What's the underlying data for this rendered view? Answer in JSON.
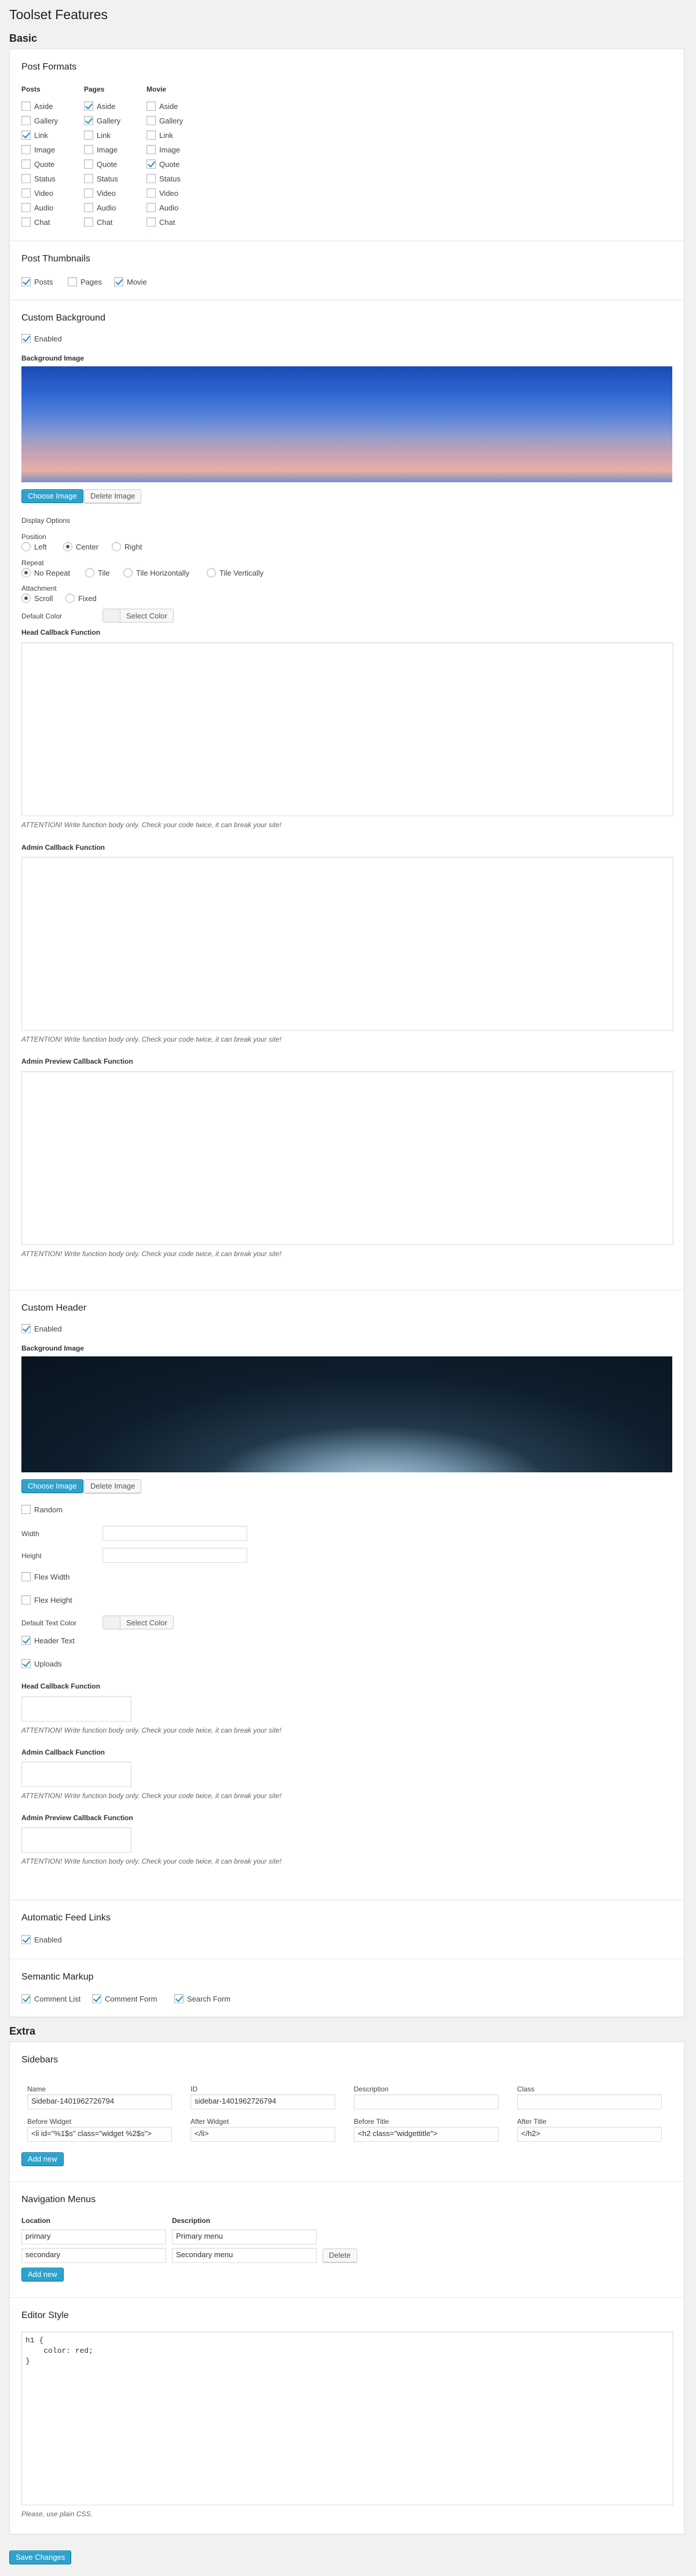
{
  "page_title": "Toolset Features",
  "basic_heading": "Basic",
  "extra_heading": "Extra",
  "post_formats": {
    "title": "Post Formats",
    "columns": [
      {
        "name": "Posts",
        "items": [
          {
            "label": "Aside",
            "checked": false
          },
          {
            "label": "Gallery",
            "checked": false
          },
          {
            "label": "Link",
            "checked": true
          },
          {
            "label": "Image",
            "checked": false
          },
          {
            "label": "Quote",
            "checked": false
          },
          {
            "label": "Status",
            "checked": false
          },
          {
            "label": "Video",
            "checked": false
          },
          {
            "label": "Audio",
            "checked": false
          },
          {
            "label": "Chat",
            "checked": false
          }
        ]
      },
      {
        "name": "Pages",
        "items": [
          {
            "label": "Aside",
            "checked": true
          },
          {
            "label": "Gallery",
            "checked": true
          },
          {
            "label": "Link",
            "checked": false
          },
          {
            "label": "Image",
            "checked": false
          },
          {
            "label": "Quote",
            "checked": false
          },
          {
            "label": "Status",
            "checked": false
          },
          {
            "label": "Video",
            "checked": false
          },
          {
            "label": "Audio",
            "checked": false
          },
          {
            "label": "Chat",
            "checked": false
          }
        ]
      },
      {
        "name": "Movie",
        "items": [
          {
            "label": "Aside",
            "checked": false
          },
          {
            "label": "Gallery",
            "checked": false
          },
          {
            "label": "Link",
            "checked": false
          },
          {
            "label": "Image",
            "checked": false
          },
          {
            "label": "Quote",
            "checked": true
          },
          {
            "label": "Status",
            "checked": false
          },
          {
            "label": "Video",
            "checked": false
          },
          {
            "label": "Audio",
            "checked": false
          },
          {
            "label": "Chat",
            "checked": false
          }
        ]
      }
    ]
  },
  "post_thumbnails": {
    "title": "Post Thumbnails",
    "items": [
      {
        "label": "Posts",
        "checked": true
      },
      {
        "label": "Pages",
        "checked": false
      },
      {
        "label": "Movie",
        "checked": true
      }
    ]
  },
  "custom_background": {
    "title": "Custom Background",
    "enabled_label": "Enabled",
    "enabled": true,
    "bg_image_label": "Background Image",
    "choose_label": "Choose Image",
    "delete_label": "Delete Image",
    "display_options_label": "Display Options",
    "position_label": "Position",
    "positions": [
      {
        "label": "Left",
        "checked": false
      },
      {
        "label": "Center",
        "checked": true
      },
      {
        "label": "Right",
        "checked": false
      }
    ],
    "repeat_label": "Repeat",
    "repeats": [
      {
        "label": "No Repeat",
        "checked": true
      },
      {
        "label": "Tile",
        "checked": false
      },
      {
        "label": "Tile Horizontally",
        "checked": false
      },
      {
        "label": "Tile Vertically",
        "checked": false
      }
    ],
    "attachment_label": "Attachment",
    "attachments": [
      {
        "label": "Scroll",
        "checked": true
      },
      {
        "label": "Fixed",
        "checked": false
      }
    ],
    "default_color_label": "Default Color",
    "select_color_label": "Select Color",
    "head_cb_label": "Head Callback Function",
    "admin_cb_label": "Admin Callback Function",
    "preview_cb_label": "Admin Preview Callback Function",
    "attention": "ATTENTION! Write function body only. Check your code twice, it can break your site!"
  },
  "custom_header": {
    "title": "Custom Header",
    "enabled_label": "Enabled",
    "enabled": true,
    "bg_image_label": "Background Image",
    "choose_label": "Choose Image",
    "delete_label": "Delete Image",
    "random_label": "Random",
    "random": false,
    "width_label": "Width",
    "width_value": "",
    "height_label": "Height",
    "height_value": "",
    "flex_width_label": "Flex Width",
    "flex_width": false,
    "flex_height_label": "Flex Height",
    "flex_height": false,
    "default_text_color_label": "Default Text Color",
    "select_color_label": "Select Color",
    "header_text_label": "Header Text",
    "header_text": true,
    "uploads_label": "Uploads",
    "uploads": true,
    "head_cb_label": "Head Callback Function",
    "admin_cb_label": "Admin Callback Function",
    "preview_cb_label": "Admin Preview Callback Function",
    "attention": "ATTENTION! Write function body only. Check your code twice, it can break your site!"
  },
  "feed_links": {
    "title": "Automatic Feed Links",
    "enabled_label": "Enabled",
    "enabled": true
  },
  "semantic_markup": {
    "title": "Semantic Markup",
    "items": [
      {
        "label": "Comment List",
        "checked": true
      },
      {
        "label": "Comment Form",
        "checked": true
      },
      {
        "label": "Search Form",
        "checked": true
      }
    ]
  },
  "sidebars": {
    "title": "Sidebars",
    "name_label": "Name",
    "name_value": "Sidebar-1401962726794",
    "id_label": "ID",
    "id_value": "sidebar-1401962726794",
    "description_label": "Description",
    "description_value": "",
    "class_label": "Class",
    "class_value": "",
    "before_widget_label": "Before Widget",
    "before_widget_value": "<li id=\"%1$s\" class=\"widget %2$s\">",
    "after_widget_label": "After Widget",
    "after_widget_value": "</li>",
    "before_title_label": "Before Title",
    "before_title_value": "<h2 class=\"widgettitle\">",
    "after_title_label": "After Title",
    "after_title_value": "</h2>",
    "add_label": "Add new"
  },
  "nav_menus": {
    "title": "Navigation Menus",
    "location_label": "Location",
    "description_label": "Description",
    "rows": [
      {
        "location": "primary",
        "description": "Primary menu"
      },
      {
        "location": "secondary",
        "description": "Secondary menu"
      }
    ],
    "delete_label": "Delete",
    "add_label": "Add new"
  },
  "editor_style": {
    "title": "Editor Style",
    "code": "h1 {\n    color: red;\n}",
    "note": "Please, use plain CSS."
  },
  "save_label": "Save Changes",
  "colors": {
    "accent": "#2ea2cc",
    "check": "#1e8cbe"
  }
}
